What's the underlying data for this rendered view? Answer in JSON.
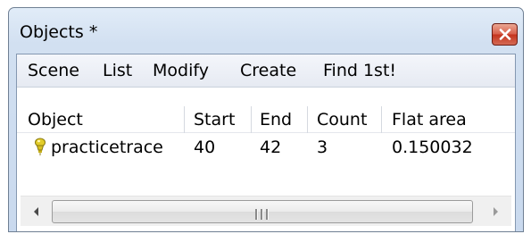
{
  "window": {
    "title": "Objects *",
    "close_icon": "close-icon",
    "colors": {
      "close_button": "#d0492f",
      "frame": "#cfdff2"
    }
  },
  "menu": {
    "items": [
      "Scene",
      "List",
      "Modify",
      "Create",
      "Find 1st!"
    ]
  },
  "table": {
    "columns": [
      "Object",
      "Start",
      "End",
      "Count",
      "Flat area"
    ],
    "rows": [
      {
        "icon": "trace-pin-icon",
        "object": "practicetrace",
        "start": "40",
        "end": "42",
        "count": "3",
        "flat_area": "0.150032"
      }
    ]
  },
  "scrollbar": {
    "left_icon": "scroll-left-icon",
    "right_icon": "scroll-right-icon"
  }
}
